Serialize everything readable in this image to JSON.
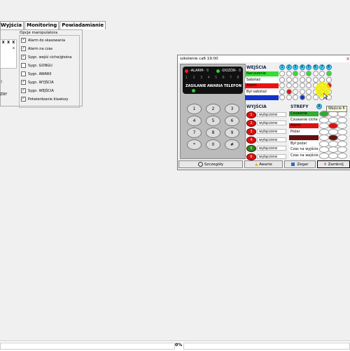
{
  "tabs": [
    "Wyjścia",
    "Monitoring",
    "Powiadamianie"
  ],
  "left_panel": {
    "grid_row": [
      "X",
      "X",
      "X"
    ],
    "grid_mark": "x",
    "options_title": "Opcje manipulatora",
    "options": [
      {
        "label": "Alarm do skasowania",
        "checked": true
      },
      {
        "label": "Alarm na czas",
        "checked": true
      },
      {
        "label": "Sygn. wejść ciche/głośna",
        "checked": true
      },
      {
        "label": "Sygn. GONGU",
        "checked": false
      },
      {
        "label": "Sygn. AWARII",
        "checked": false
      },
      {
        "label": "Sygn. WYJŚCIA",
        "checked": true
      },
      {
        "label": "Sygn. WEJŚCIA",
        "checked": true
      },
      {
        "label": "Potwierdzanie klawiszy",
        "checked": true
      }
    ],
    "fragment_label": "ZNY",
    "fragment_paren": ")"
  },
  "window": {
    "title": "szkolenie ca6  19:00",
    "close": "×",
    "keypad": {
      "alarm_label": "-ALARM-",
      "alarm_num": "8",
      "dozor_label": "-DOZÓR-",
      "dozor_num": "8",
      "zone_numbers": [
        "1",
        "2",
        "3",
        "4",
        "5",
        "6",
        "7",
        "8"
      ],
      "status_labels": [
        "ZASILANIE",
        "AWARIA",
        "TELEFON"
      ],
      "keys": [
        "1",
        "2",
        "3",
        "4",
        "5",
        "6",
        "7",
        "8",
        "9",
        "*",
        "0",
        "#"
      ]
    },
    "wejscia": {
      "title": "WEJŚCIA",
      "rows": [
        {
          "label": "Naruszenie",
          "color": "#33dd33"
        },
        {
          "label": "Sabotaż",
          "color": "#ffffff"
        },
        {
          "label": "Alarm",
          "color": "#ee1111"
        },
        {
          "label": "Był sabotaż",
          "color": "#ffffff"
        },
        {
          "label": "",
          "color": "#1133cc"
        }
      ],
      "column_numbers": [
        "1",
        "2",
        "3",
        "4",
        "5",
        "6",
        "7",
        "8"
      ]
    },
    "wyjscia": {
      "title": "WYJŚCIA",
      "items": [
        {
          "num": "1",
          "label": "wyłączone",
          "color": "#dd1111"
        },
        {
          "num": "2",
          "label": "wyłączone",
          "color": "#dd1111"
        },
        {
          "num": "3",
          "label": "wyłączone",
          "color": "#dd1111"
        },
        {
          "num": "4",
          "label": "wyłączone",
          "color": "#dd1111"
        },
        {
          "num": "5",
          "label": "wyłączone",
          "color": "#228822"
        },
        {
          "num": "6",
          "label": "wyłączone",
          "color": "#dd1111"
        }
      ]
    },
    "strefy": {
      "title": "STREFY",
      "header_letter": "A",
      "tooltip": "Wejście 6",
      "rows": [
        {
          "label": "Czuwanie",
          "color": "#33aa33"
        },
        {
          "label": "Czuwanie ciche",
          "color": "#ffffff"
        },
        {
          "label": "Alarm",
          "color": "#dd1111"
        },
        {
          "label": "Pożar",
          "color": "#ffffff"
        },
        {
          "label": "",
          "color": "#661111"
        },
        {
          "label": "Był pożar",
          "color": "#ffffff"
        },
        {
          "label": "Czas na wyjście",
          "color": "#ffffff"
        },
        {
          "label": "Czas na wejście",
          "color": "#ffffff"
        }
      ]
    },
    "buttons": [
      {
        "label": "Szczegóły",
        "icon": "details-icon"
      },
      {
        "label": "Awarie",
        "icon": "warning-icon"
      },
      {
        "label": "Zegar",
        "icon": "clock-icon"
      },
      {
        "label": "Zamknij",
        "icon": "close-x-icon"
      }
    ]
  },
  "statusbar": {
    "progress": "0%"
  }
}
